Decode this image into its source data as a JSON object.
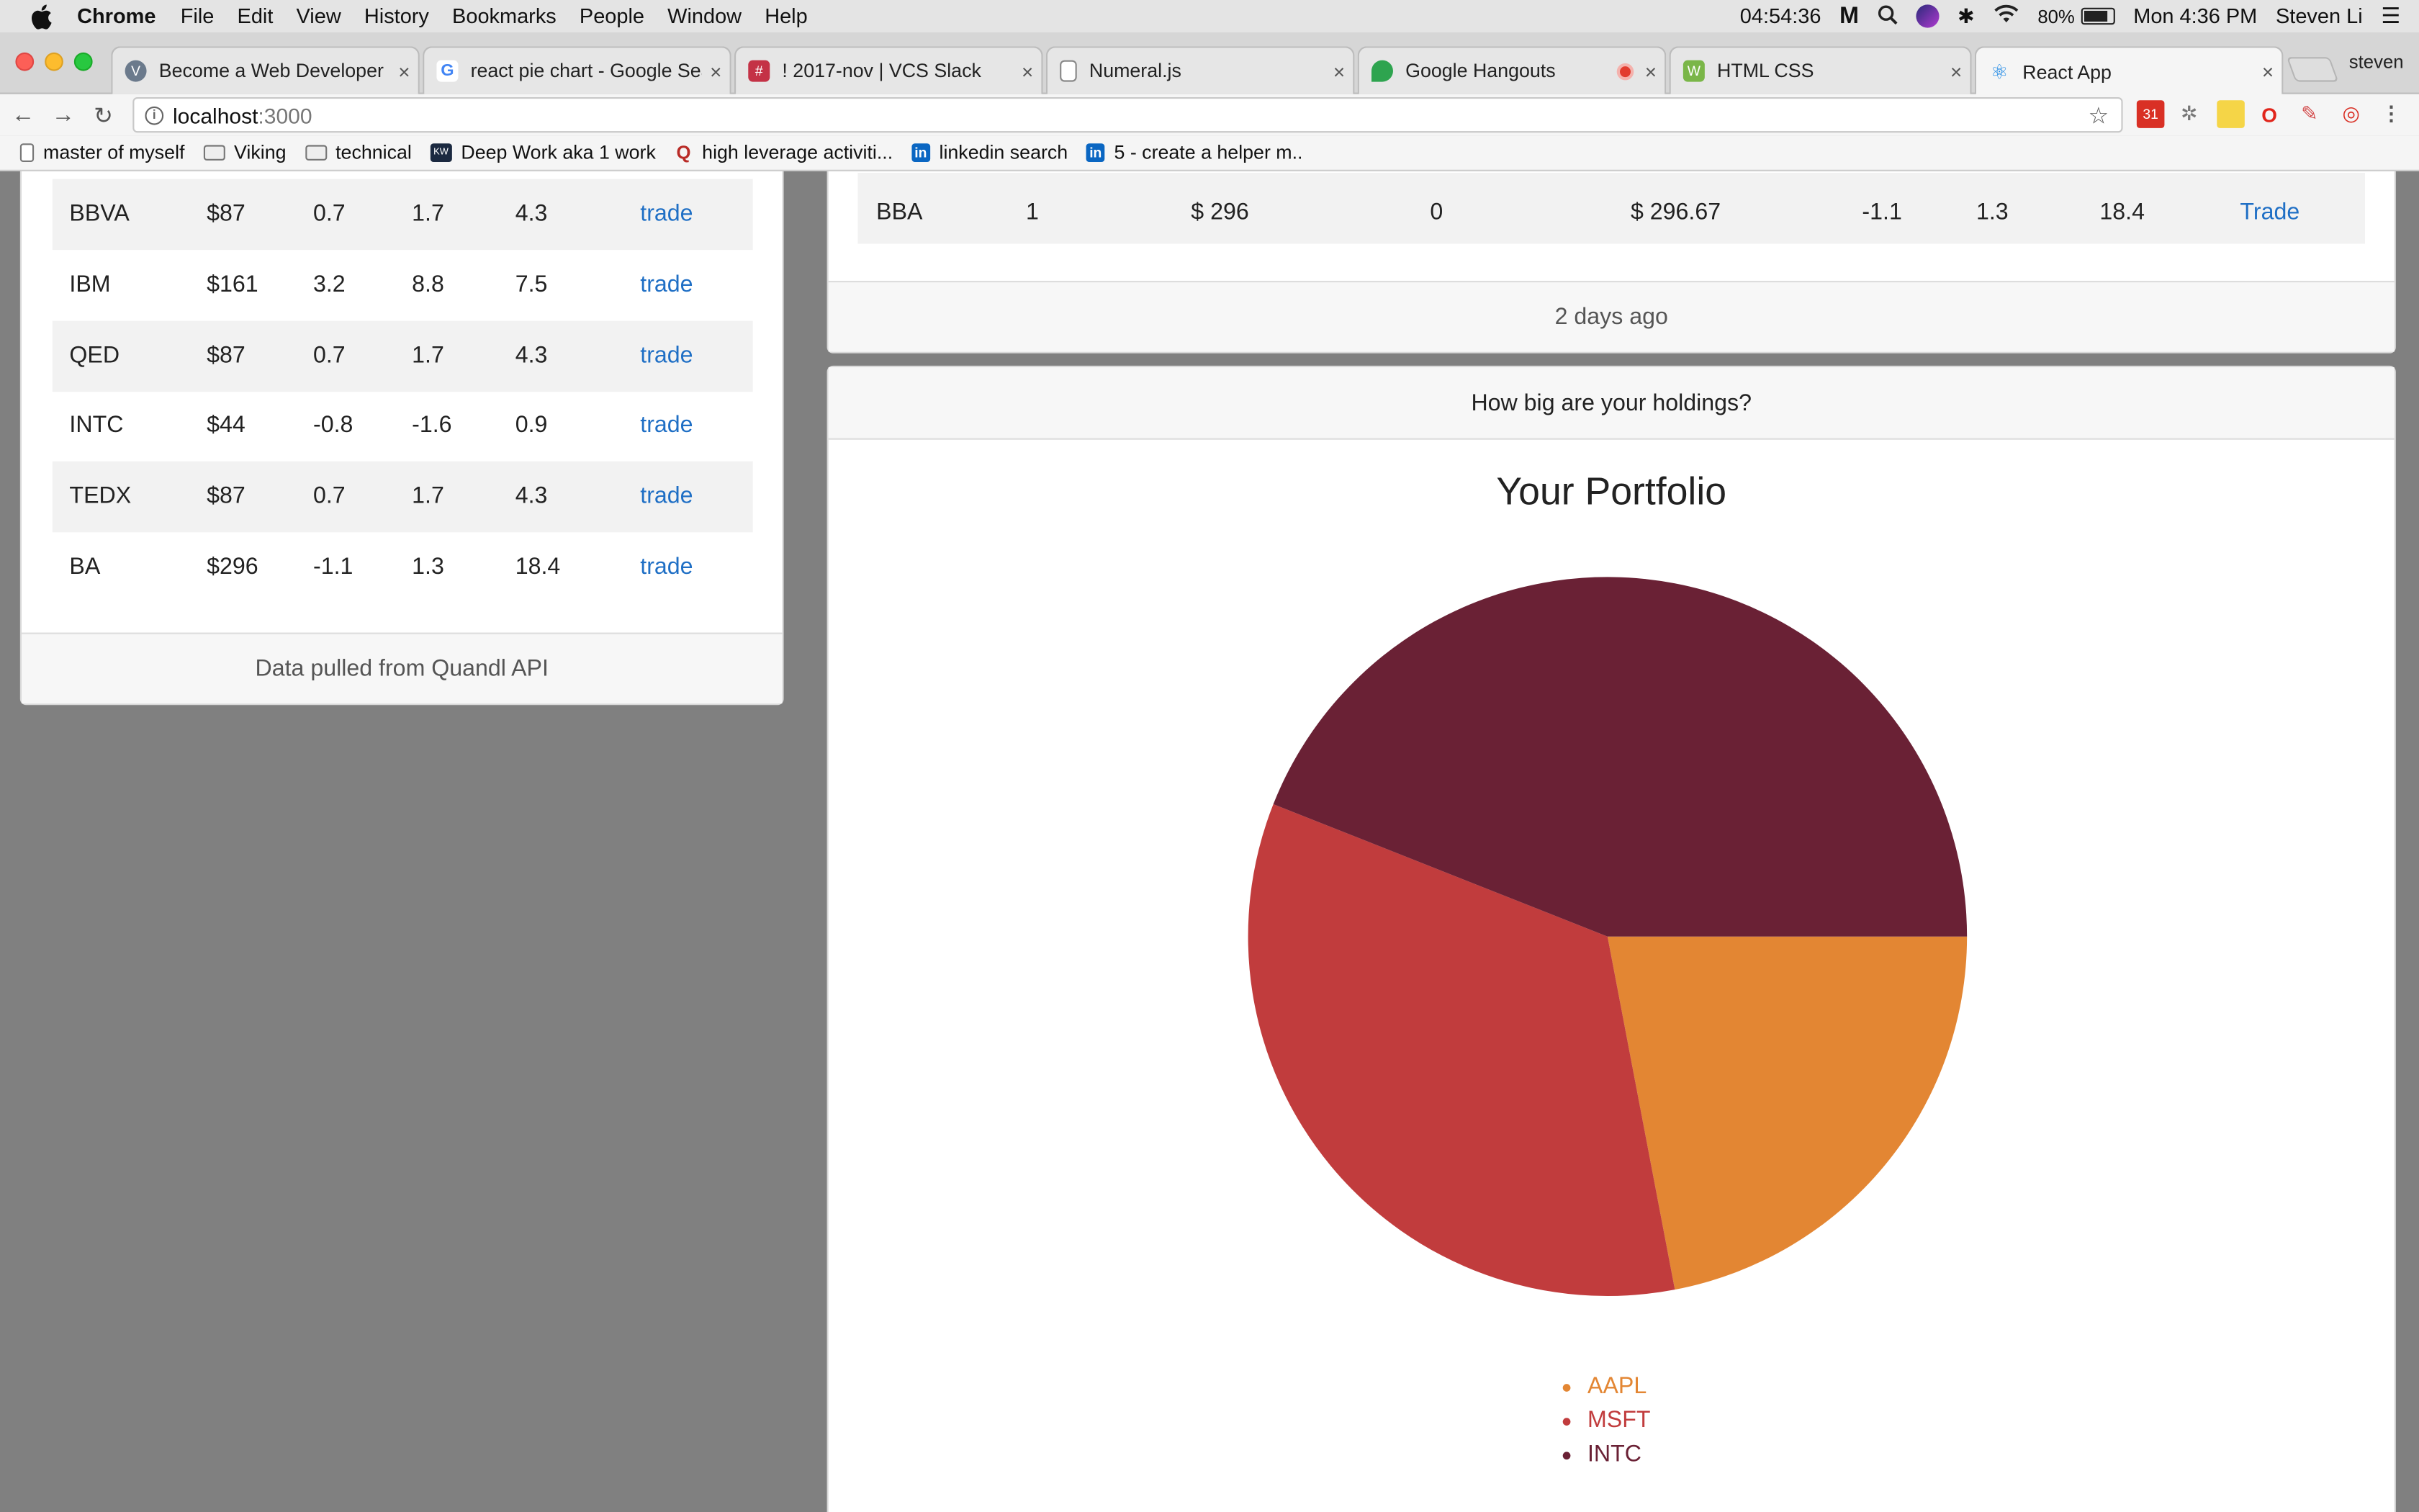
{
  "menubar": {
    "app": "Chrome",
    "items": [
      "File",
      "Edit",
      "View",
      "History",
      "Bookmarks",
      "People",
      "Window",
      "Help"
    ],
    "timer": "04:54:36",
    "battery": "80%",
    "clock": "Mon 4:36 PM",
    "user": "Steven Li"
  },
  "tabs": [
    {
      "title": "Become a Web Developer | V",
      "favicon_color": "#6b7a8c",
      "icon": "viking-icon"
    },
    {
      "title": "react pie chart - Google Sea",
      "favicon_color": "#4285f4",
      "icon": "google-icon"
    },
    {
      "title": "! 2017-nov | VCS Slack",
      "favicon_color": "#c43246",
      "icon": "slack-icon"
    },
    {
      "title": "Numeral.js",
      "favicon_color": "#999999",
      "icon": "document-icon"
    },
    {
      "title": "Google Hangouts",
      "favicon_color": "#2ea44f",
      "icon": "hangouts-icon"
    },
    {
      "title": "HTML CSS",
      "favicon_color": "#7ab648",
      "icon": "codepen-icon"
    },
    {
      "title": "React App",
      "favicon_color": "#1e88e5",
      "icon": "react-icon"
    }
  ],
  "profile": "steven",
  "address": {
    "host": "localhost",
    "port": ":3000"
  },
  "bookmarks": [
    {
      "label": "master of myself",
      "icon": "page-icon"
    },
    {
      "label": "Viking",
      "icon": "folder-icon"
    },
    {
      "label": "technical",
      "icon": "folder-icon"
    },
    {
      "label": "Deep Work aka 1 work",
      "icon": "site-icon"
    },
    {
      "label": "high leverage activiti...",
      "icon": "quora-icon"
    },
    {
      "label": "linkedin search",
      "icon": "linkedin-icon"
    },
    {
      "label": "5 - create a helper m..",
      "icon": "linkedin-icon"
    }
  ],
  "stocks": {
    "rows": [
      {
        "symbol": "BBVA",
        "price": "$87",
        "c1": "0.7",
        "c2": "1.7",
        "c3": "4.3",
        "action": "trade"
      },
      {
        "symbol": "IBM",
        "price": "$161",
        "c1": "3.2",
        "c2": "8.8",
        "c3": "7.5",
        "action": "trade"
      },
      {
        "symbol": "QED",
        "price": "$87",
        "c1": "0.7",
        "c2": "1.7",
        "c3": "4.3",
        "action": "trade"
      },
      {
        "symbol": "INTC",
        "price": "$44",
        "c1": "-0.8",
        "c2": "-1.6",
        "c3": "0.9",
        "action": "trade"
      },
      {
        "symbol": "TEDX",
        "price": "$87",
        "c1": "0.7",
        "c2": "1.7",
        "c3": "4.3",
        "action": "trade"
      },
      {
        "symbol": "BA",
        "price": "$296",
        "c1": "-1.1",
        "c2": "1.3",
        "c3": "18.4",
        "action": "trade"
      }
    ],
    "footer": "Data pulled from Quandl API"
  },
  "holdings": {
    "row": {
      "symbol": "BBA",
      "qty": "1",
      "price": "$ 296",
      "zero": "0",
      "value": "$ 296.67",
      "c1": "-1.1",
      "c2": "1.3",
      "c3": "18.4",
      "action": "Trade"
    },
    "footer": "2 days ago"
  },
  "portfolio": {
    "header": "How big are your holdings?",
    "chart_data": {
      "type": "pie",
      "title": "Your Portfolio",
      "slices": [
        {
          "label": "AAPL",
          "value": 22,
          "color": "#e38633"
        },
        {
          "label": "MSFT",
          "value": 34,
          "color": "#c13c3d"
        },
        {
          "label": "INTC",
          "value": 44,
          "color": "#6a2135"
        }
      ]
    }
  }
}
